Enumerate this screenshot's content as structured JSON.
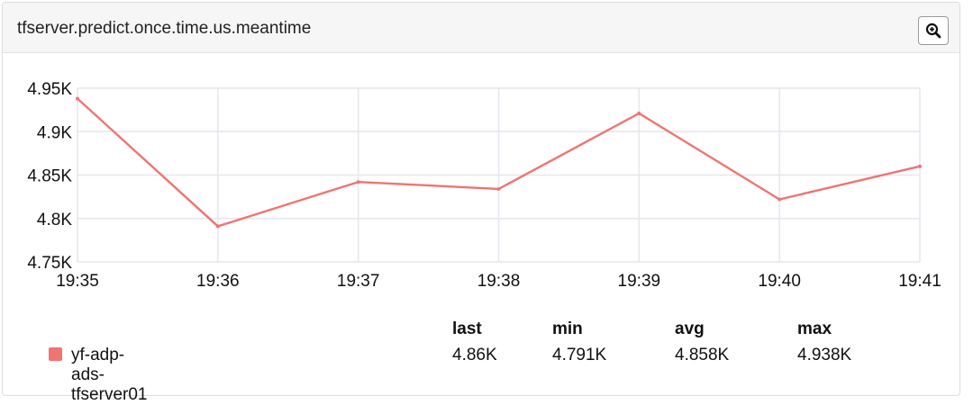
{
  "panel": {
    "title": "tfserver.predict.once.time.us.meantime",
    "zoom_icon": "zoom-in-icon"
  },
  "colors": {
    "series": "#f07472",
    "grid": "#e6e6ef",
    "axis": "#e6e6ef"
  },
  "chart_data": {
    "type": "line",
    "title": "tfserver.predict.once.time.us.meantime",
    "xlabel": "",
    "ylabel": "",
    "categories": [
      "19:35",
      "19:36",
      "19:37",
      "19:38",
      "19:39",
      "19:40",
      "19:41"
    ],
    "y_ticks": [
      "4.75K",
      "4.8K",
      "4.85K",
      "4.9K",
      "4.95K"
    ],
    "y_tick_values": [
      4750,
      4800,
      4850,
      4900,
      4950
    ],
    "ylim": [
      4750,
      4950
    ],
    "grid": true,
    "legend_position": "bottom",
    "series": [
      {
        "name": "yf-adp-ads-tfserver01",
        "values": [
          4938,
          4791,
          4842,
          4834,
          4921,
          4822,
          4860
        ]
      }
    ]
  },
  "legend": {
    "headers": [
      "last",
      "min",
      "avg",
      "max"
    ],
    "rows": [
      {
        "name": "yf-adp-ads-tfserver01",
        "values": [
          "4.86K",
          "4.791K",
          "4.858K",
          "4.938K"
        ]
      }
    ]
  }
}
